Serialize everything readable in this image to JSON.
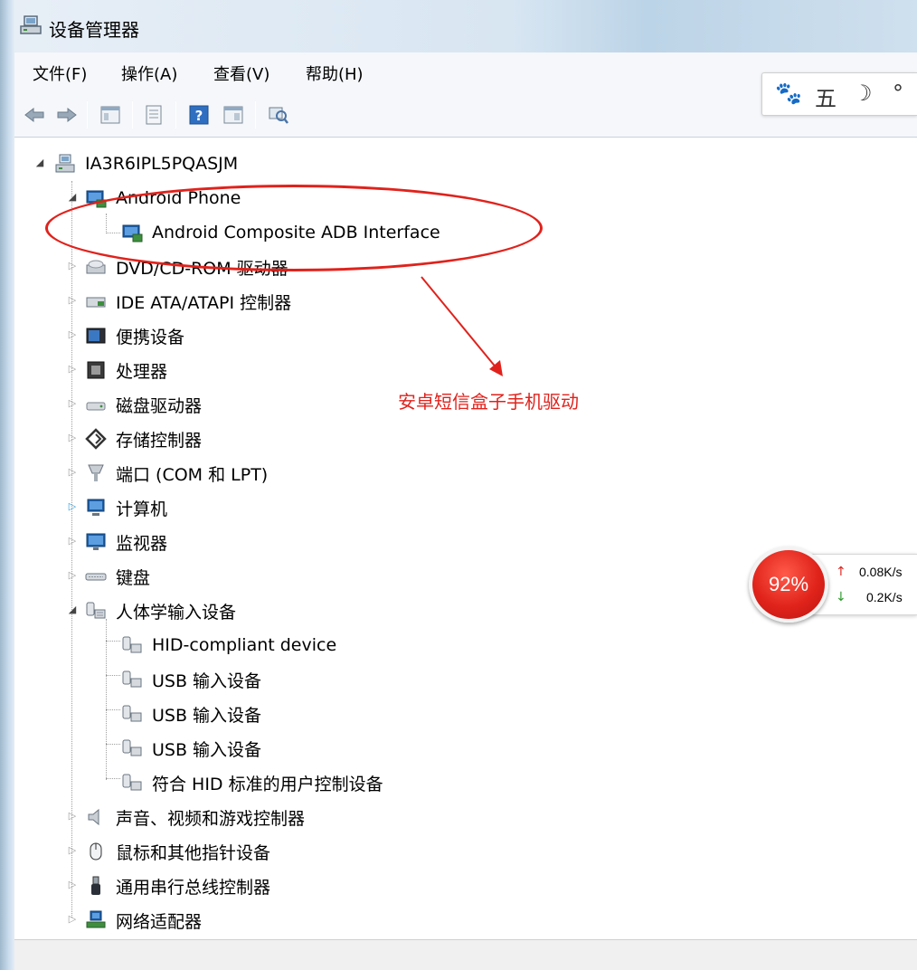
{
  "window": {
    "title": "设备管理器"
  },
  "menu": [
    "文件(F)",
    "操作(A)",
    "查看(V)",
    "帮助(H)"
  ],
  "toolbar": {
    "buttons": [
      "back-arrow-icon",
      "forward-arrow-icon",
      "properties-icon",
      "console-icon",
      "help-icon",
      "view-icon",
      "scan-hardware-icon"
    ]
  },
  "ime": {
    "items": [
      "🐾",
      "五",
      "☽",
      "°"
    ]
  },
  "tree": {
    "root": "IA3R6IPL5PQASJM",
    "android_phone": "Android Phone",
    "adb": "Android Composite ADB Interface",
    "dvd": "DVD/CD-ROM 驱动器",
    "ide": "IDE ATA/ATAPI 控制器",
    "portable": "便携设备",
    "cpu": "处理器",
    "disk": "磁盘驱动器",
    "storage": "存储控制器",
    "ports": "端口 (COM 和 LPT)",
    "computer": "计算机",
    "monitor": "监视器",
    "keyboard": "键盘",
    "hid": "人体学输入设备",
    "hid_children": [
      "HID-compliant device",
      "USB 输入设备",
      "USB 输入设备",
      "USB 输入设备",
      "符合 HID 标准的用户控制设备"
    ],
    "sound": "声音、视频和游戏控制器",
    "mouse": "鼠标和其他指针设备",
    "usb": "通用串行总线控制器",
    "network": "网络适配器"
  },
  "annotation": {
    "text": "安卓短信盒子手机驱动"
  },
  "speed": {
    "percent": "92%",
    "upload": "0.08K/s",
    "download": "0.2K/s",
    "colors": {
      "up": "#e0221c",
      "down": "#2c9a2c"
    }
  }
}
